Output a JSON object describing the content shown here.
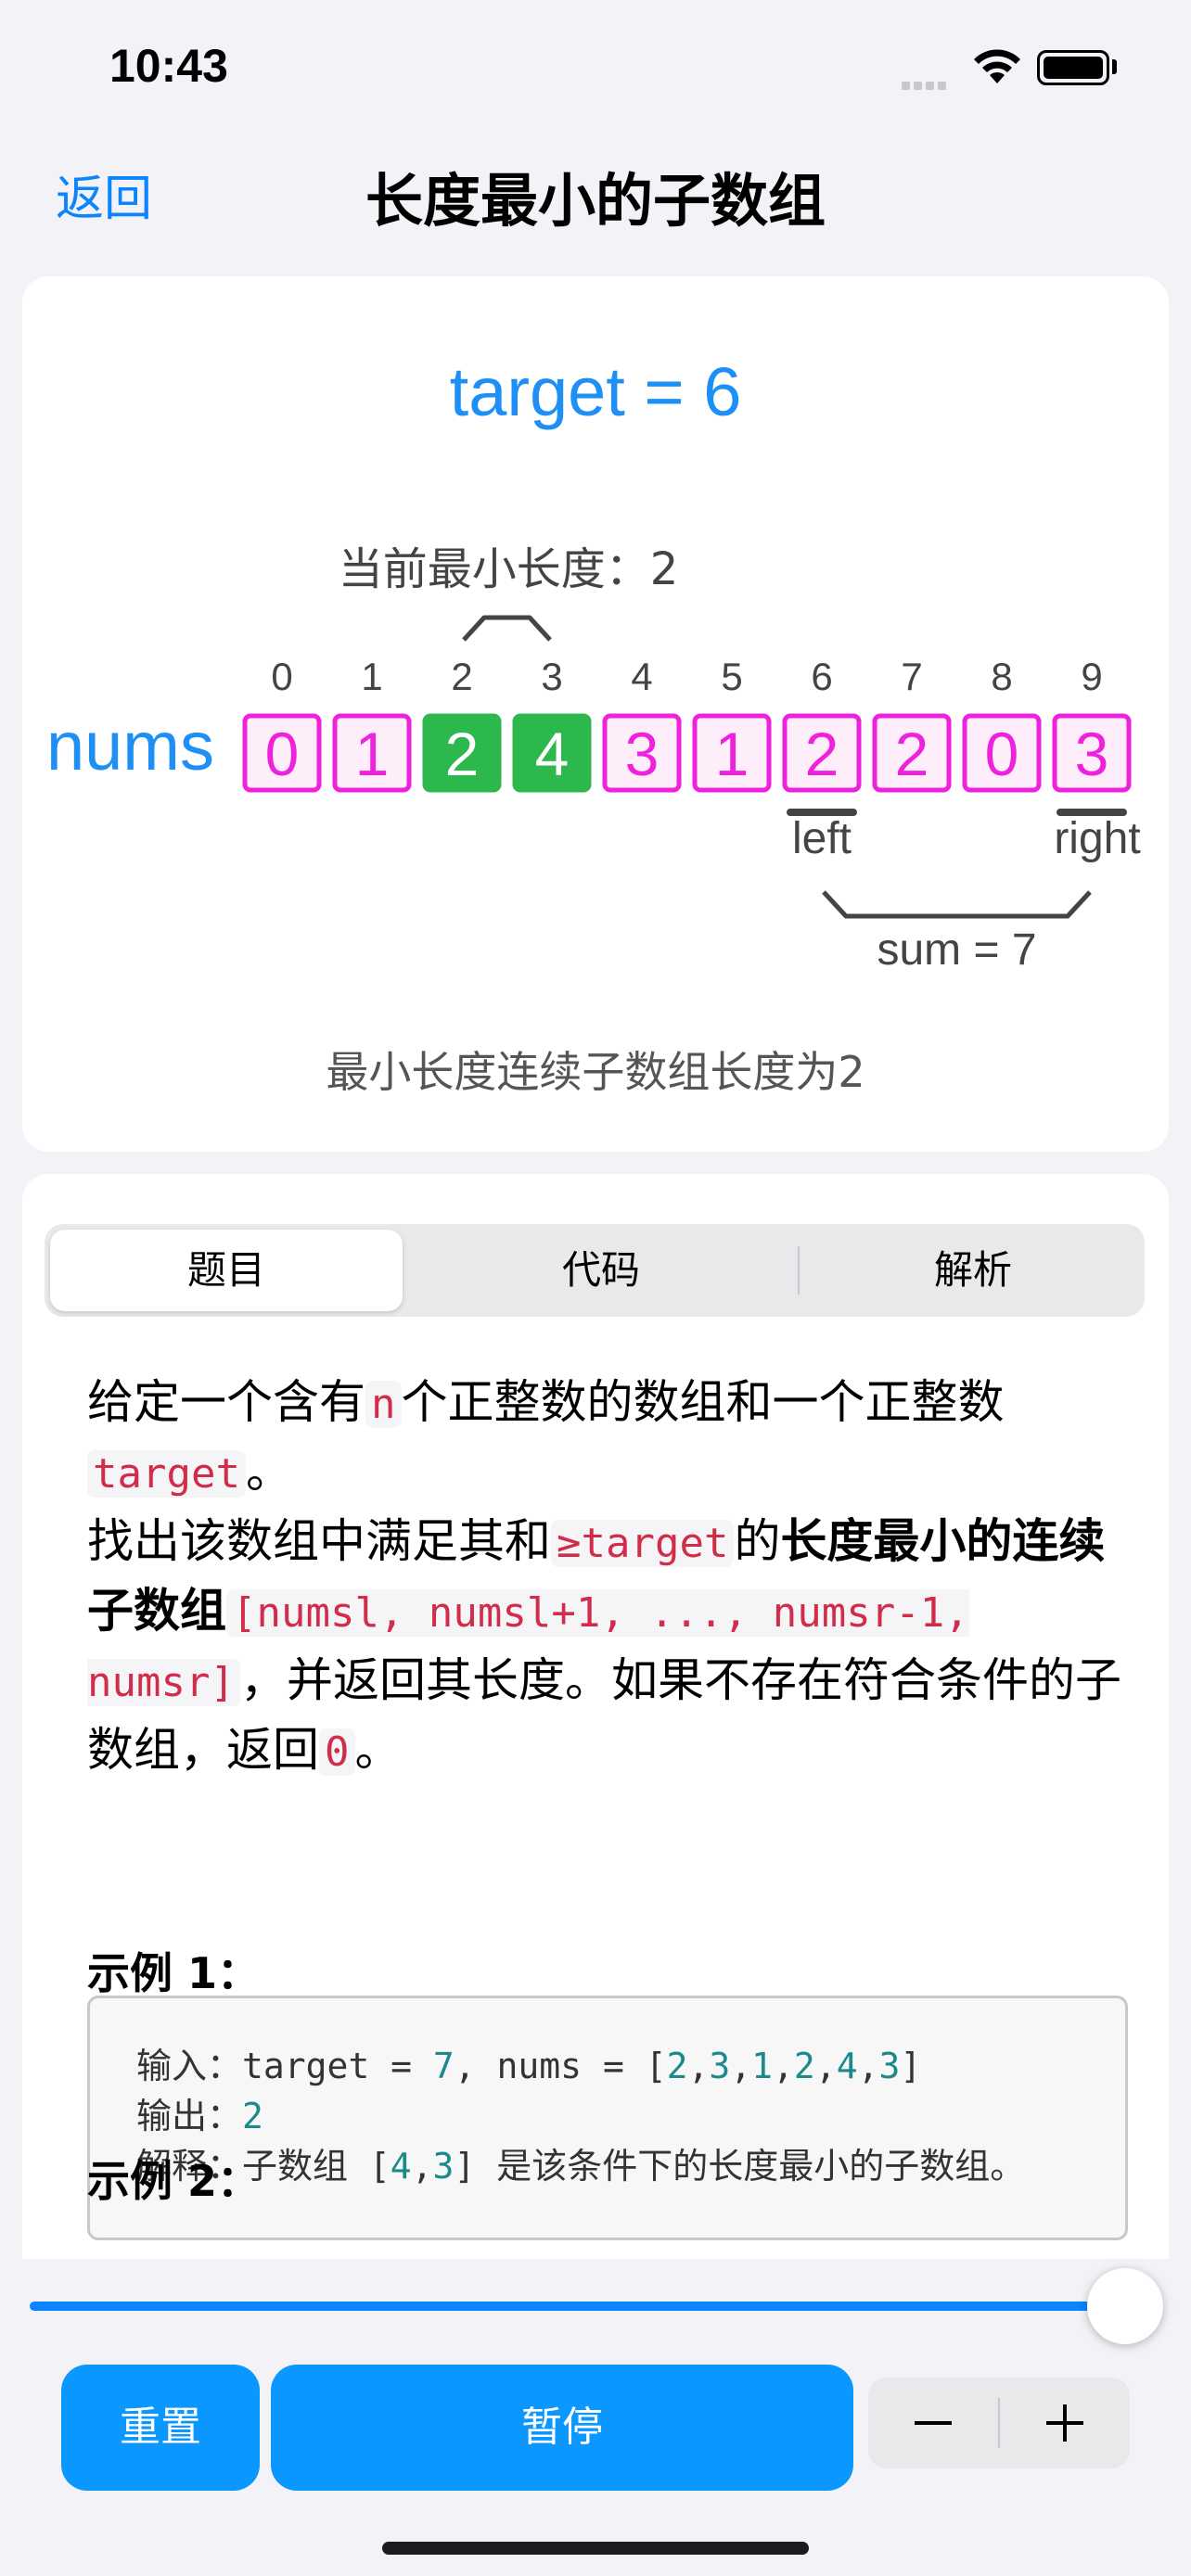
{
  "status_bar": {
    "time": "10:43"
  },
  "nav": {
    "back_label": "返回",
    "title": "长度最小的子数组"
  },
  "visual": {
    "target_label": "target = 6",
    "min_length_label": "当前最小长度：2",
    "array_label": "nums",
    "indices": [
      "0",
      "1",
      "2",
      "3",
      "4",
      "5",
      "6",
      "7",
      "8",
      "9"
    ],
    "values": [
      "0",
      "1",
      "2",
      "4",
      "3",
      "1",
      "2",
      "2",
      "0",
      "3"
    ],
    "highlighted": [
      2,
      3
    ],
    "left_label": "left",
    "right_label": "right",
    "sum_label": "sum = 7",
    "result_text": "最小长度连续子数组长度为2",
    "colors": {
      "accent": "#1e8ff5",
      "cell_border": "#ee22dd",
      "cell_fill": "#fdeefa",
      "highlight": "#2db84e"
    }
  },
  "tabs": [
    "题目",
    "代码",
    "解析"
  ],
  "problem": {
    "p1_a": "给定一个含有",
    "p1_code_n": "n",
    "p1_b": "个正整数的数组和一个正整数",
    "p1_code_target": "target",
    "p1_c": "。",
    "p2_a": "找出该数组中满足其和",
    "p2_code": "≥target",
    "p2_b": "的",
    "p2_bold": "长度最小的连续子数组",
    "p2_code_range": "[numsl, numsl+1, ..., numsr-1, numsr]",
    "p2_c": "，并返回其长度。如果不存在符合条件的子数组，返回",
    "p2_code_zero": "0",
    "p2_d": "。"
  },
  "example1": {
    "title": "示例 1：",
    "line1_a": "输入：target = ",
    "line1_target": "7",
    "line1_b": ", nums = [",
    "nums": [
      "2",
      "3",
      "1",
      "2",
      "4",
      "3"
    ],
    "line1_c": "]",
    "line2_a": "输出：",
    "line2_value": "2",
    "line3_a": "解释：子数组 [",
    "line3_n1": "4",
    "line3_n2": "3",
    "line3_b": "] 是该条件下的长度最小的子数组。"
  },
  "example2": {
    "title": "示例 2："
  },
  "controls": {
    "reset_label": "重置",
    "pause_label": "暂停",
    "minus_label": "−",
    "plus_label": "+"
  },
  "slider": {
    "progress": 1.0
  }
}
